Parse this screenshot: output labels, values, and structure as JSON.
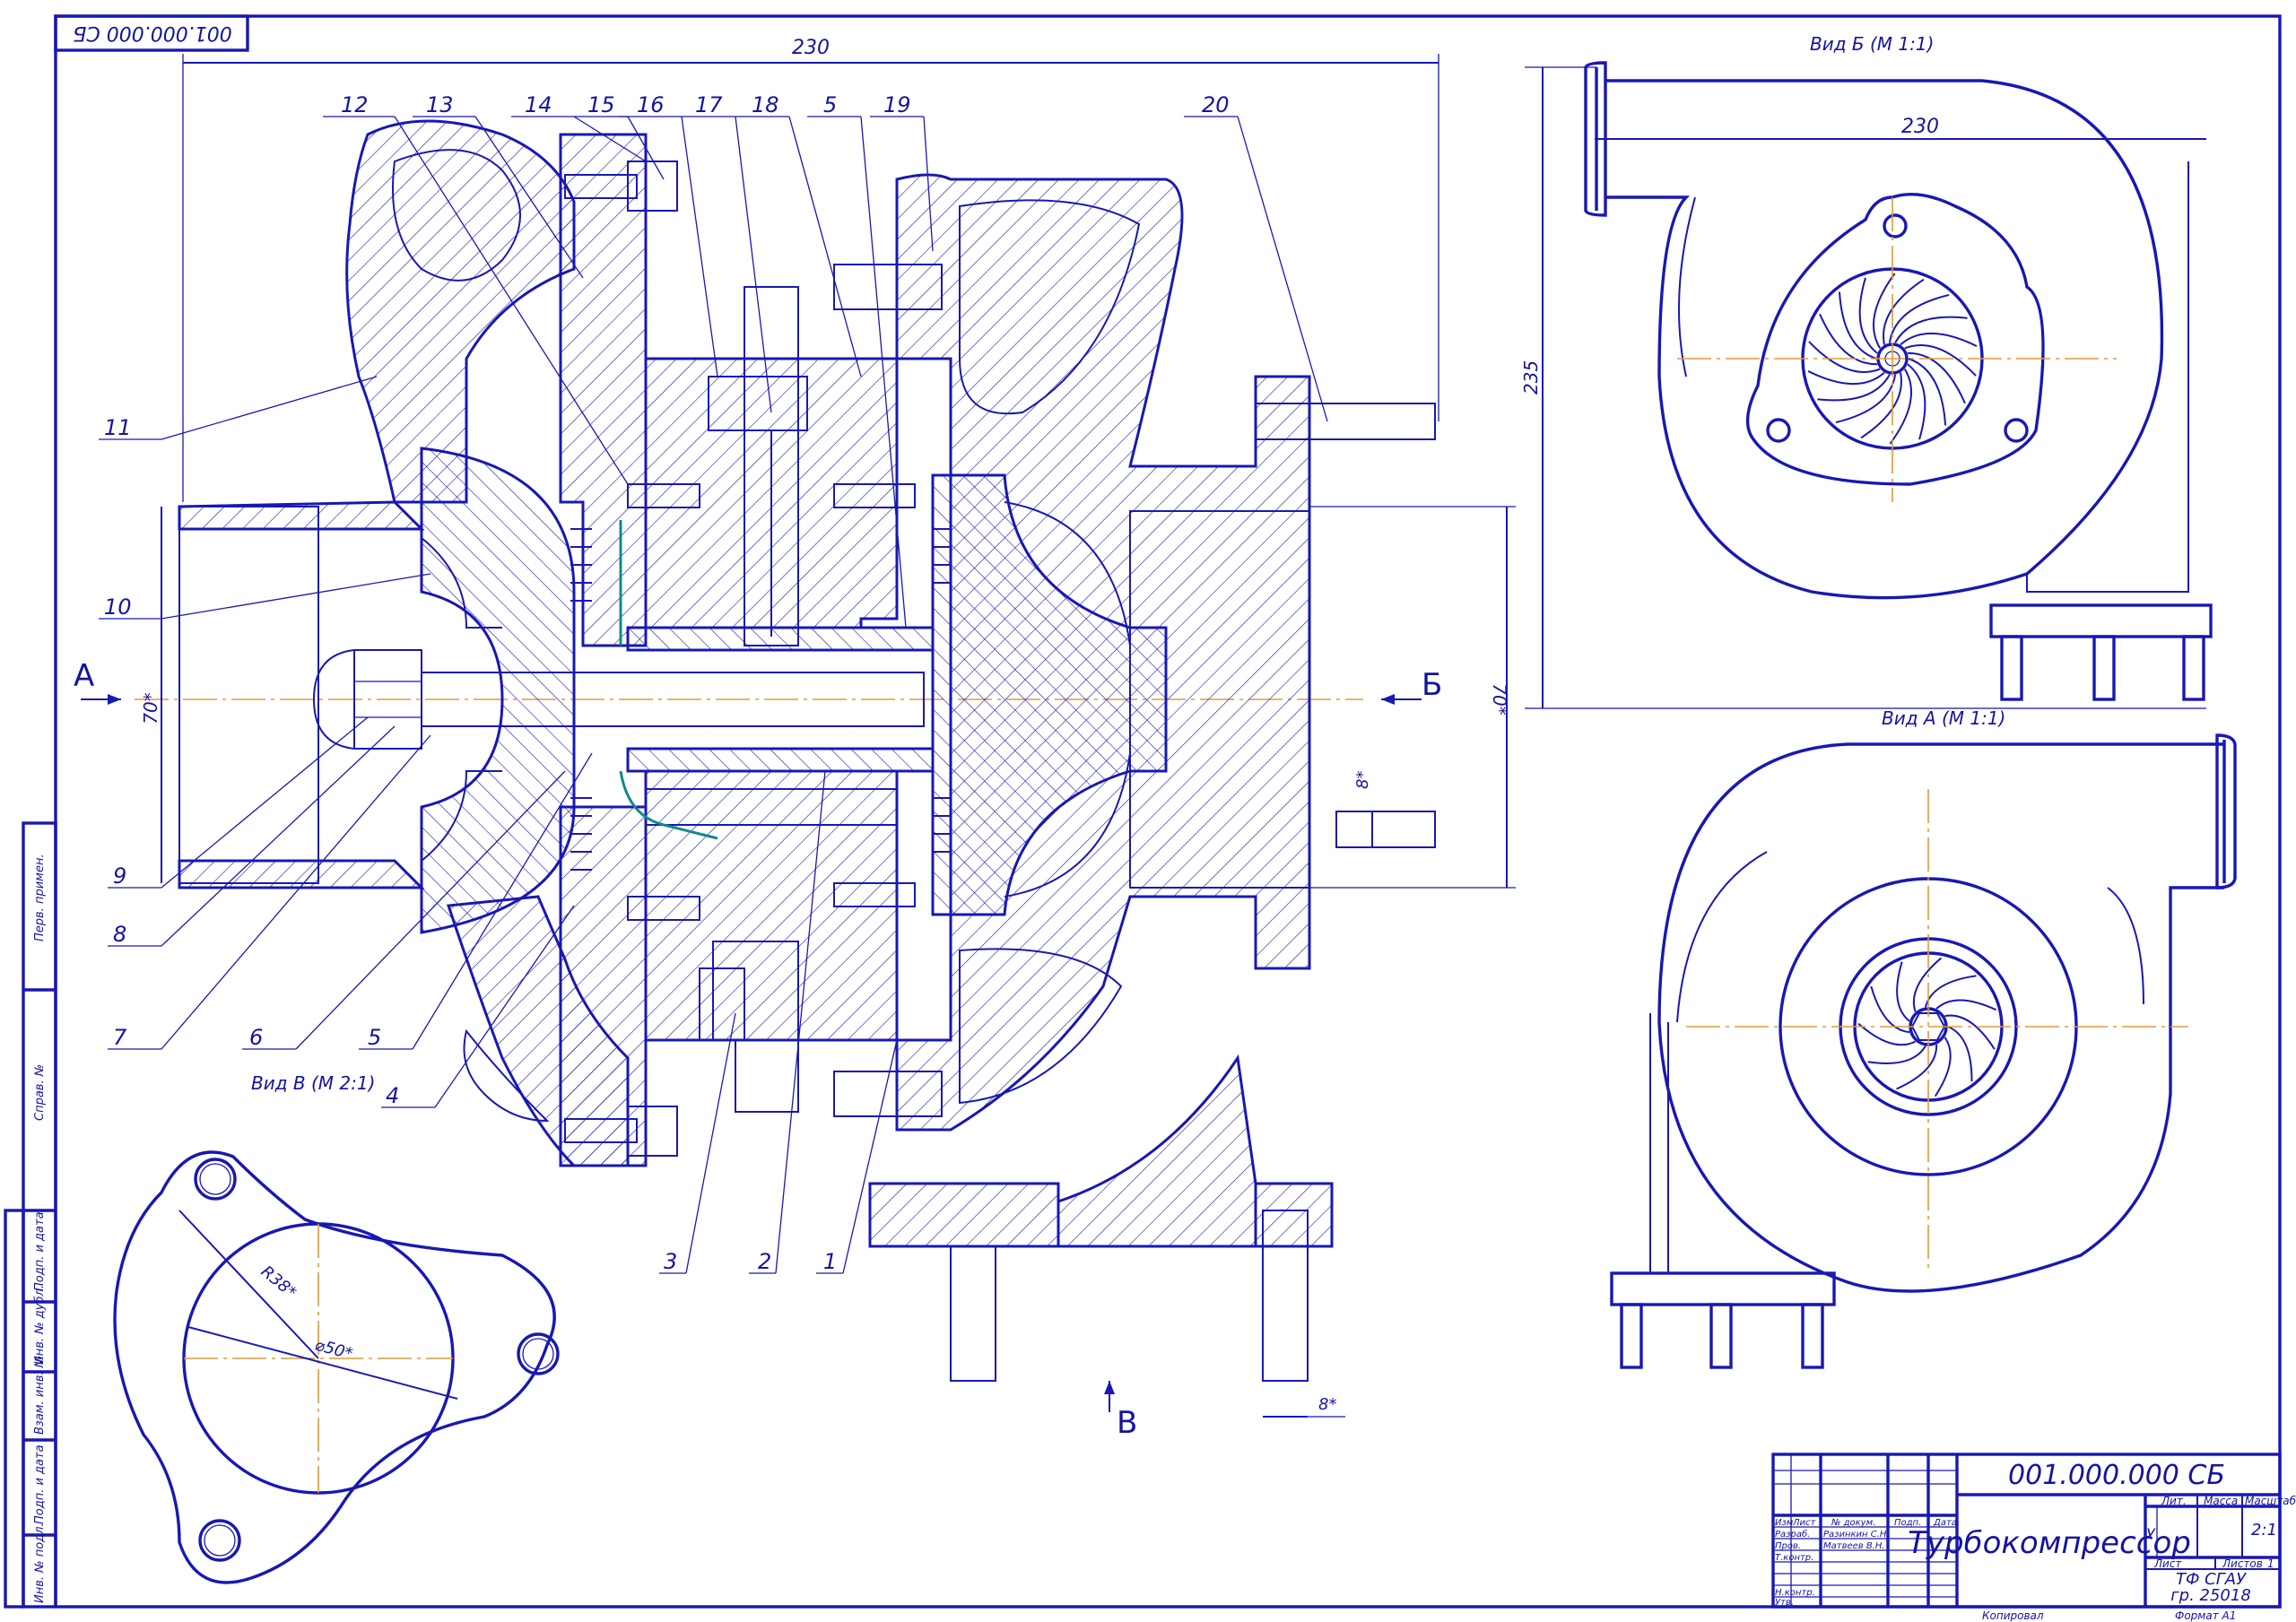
{
  "stamp_top": "001.000.000 СБ",
  "views": {
    "view_b": "Вид Б (М 1:1)",
    "view_a": "Вид А (М 1:1)",
    "view_v": "Вид В (М 2:1)"
  },
  "section_marks": {
    "a": "А",
    "b": "Б",
    "v": "В"
  },
  "dimensions": {
    "top_230": "230",
    "view_b_230": "230",
    "view_b_235": "235",
    "left_70": "70*",
    "right_70": "70*",
    "r38": "R38*",
    "d50": "⌀50*",
    "stud_8a": "8*",
    "stud_8b": "8*"
  },
  "callouts": [
    "12",
    "13",
    "14",
    "15",
    "16",
    "17",
    "18",
    "5",
    "19",
    "20",
    "11",
    "10",
    "9",
    "8",
    "7",
    "6",
    "5",
    "4",
    "3",
    "2",
    "1"
  ],
  "side_strip": [
    "Перв. примен.",
    "Справ. №",
    "Подп. и дата",
    "Инв. № дубл.",
    "Взам. инв. №",
    "Подп. и дата",
    "Инв. № подл."
  ],
  "title_block": {
    "doc_number": "001.000.000 СБ",
    "title": "Турбокомпрессор",
    "headers": {
      "izm": "Изм",
      "list": "Лист",
      "ndoc": "№ докум.",
      "podp": "Подп.",
      "data": "Дата"
    },
    "roles": [
      {
        "role": "Разраб.",
        "name": "Разинкин С.Н."
      },
      {
        "role": "Пров.",
        "name": "Матвеев В.Н."
      },
      {
        "role": "Т.контр.",
        "name": ""
      },
      {
        "role": "Н.контр.",
        "name": ""
      },
      {
        "role": "Утв.",
        "name": ""
      }
    ],
    "lit_label": "Лит.",
    "mass_label": "Масса",
    "scale_label": "Масштаб",
    "lit_value": "У",
    "scale_value": "2:1",
    "sheet_label": "Лист",
    "sheets_label": "Листов",
    "sheets_value": "1",
    "org_line1": "ТФ СГАУ",
    "org_line2": "гр. 25018",
    "copied": "Копировал",
    "format": "Формат   А1"
  }
}
